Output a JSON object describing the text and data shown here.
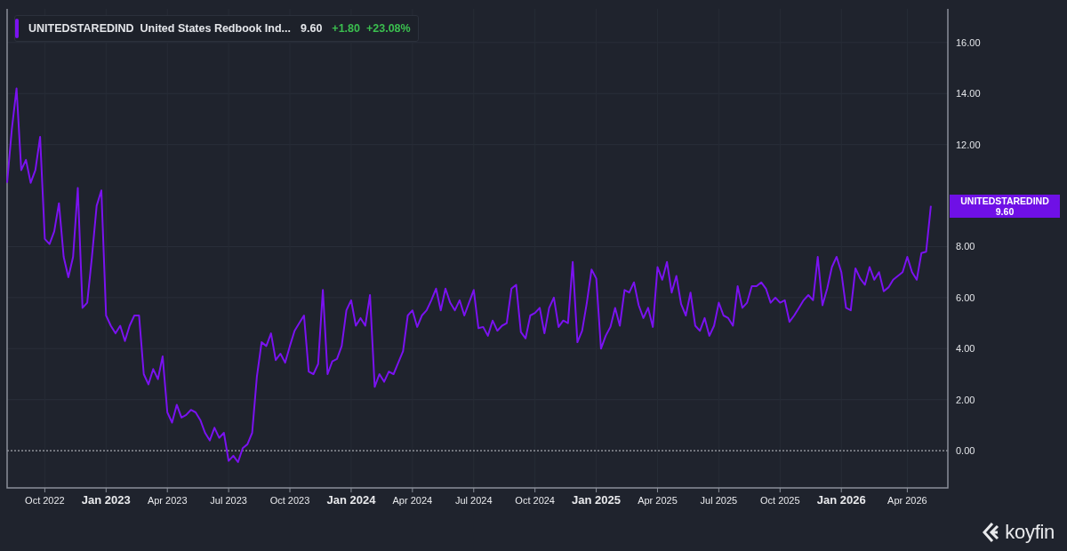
{
  "legend": {
    "name": "United States Redbook Ind...",
    "value": "9.60",
    "change": "+1.80",
    "change_percent": "+23.08%",
    "color": "#7a12f0"
  },
  "price_tag": {
    "ticker": "UNITEDSTAREDIND",
    "value": "9.60"
  },
  "chart": {
    "bold_xticks": [
      false,
      true,
      false,
      false,
      false,
      true,
      false,
      false,
      false,
      true,
      false,
      false,
      false,
      true,
      false
    ],
    "chart_data": {
      "type": "line",
      "grid": true,
      "ref_lines": [
        {
          "axis": "y",
          "value": 0
        }
      ],
      "ylim": [
        -1.46,
        17.32
      ],
      "categories": [
        null,
        null,
        null,
        null,
        null,
        null,
        null,
        null,
        "Oct 2022",
        null,
        null,
        null,
        null,
        null,
        null,
        null,
        null,
        null,
        null,
        null,
        null,
        "Jan 2023",
        null,
        null,
        null,
        null,
        null,
        null,
        null,
        null,
        null,
        null,
        null,
        null,
        "Apr 2023",
        null,
        null,
        null,
        null,
        null,
        null,
        null,
        null,
        null,
        null,
        null,
        null,
        "Jul 2023",
        null,
        null,
        null,
        null,
        null,
        null,
        null,
        null,
        null,
        null,
        null,
        null,
        "Oct 2023",
        null,
        null,
        null,
        null,
        null,
        null,
        null,
        null,
        null,
        null,
        null,
        null,
        "Jan 2024",
        null,
        null,
        null,
        null,
        null,
        null,
        null,
        null,
        null,
        null,
        null,
        null,
        "Apr 2024",
        null,
        null,
        null,
        null,
        null,
        null,
        null,
        null,
        null,
        null,
        null,
        null,
        "Jul 2024",
        null,
        null,
        null,
        null,
        null,
        null,
        null,
        null,
        null,
        null,
        null,
        null,
        "Oct 2024",
        null,
        null,
        null,
        null,
        null,
        null,
        null,
        null,
        null,
        null,
        null,
        null,
        "Jan 2025",
        null,
        null,
        null,
        null,
        null,
        null,
        null,
        null,
        null,
        null,
        null,
        null,
        "Apr 2025",
        null,
        null,
        null,
        null,
        null,
        null,
        null,
        null,
        null,
        null,
        null,
        null,
        "Jul 2025",
        null,
        null,
        null,
        null,
        null,
        null,
        null,
        null,
        null,
        null,
        null,
        null,
        "Oct 2025",
        null,
        null,
        null,
        null,
        null,
        null,
        null,
        null,
        null,
        null,
        null,
        null,
        "Jan 2026",
        null,
        null,
        null,
        null,
        null,
        null,
        null,
        null,
        null,
        null,
        null,
        null,
        null,
        "Apr 2026",
        null,
        null,
        null,
        null,
        null
      ],
      "yticks": [
        {
          "value": 0,
          "label": "0.00"
        },
        {
          "value": 2,
          "label": "2.00"
        },
        {
          "value": 4,
          "label": "4.00"
        },
        {
          "value": 6,
          "label": "6.00"
        },
        {
          "value": 8,
          "label": "8.00"
        },
        {
          "value": 12,
          "label": "12.00"
        },
        {
          "value": 14,
          "label": "14.00"
        },
        {
          "value": 16,
          "label": "16.00"
        }
      ],
      "series": [
        {
          "name": "UNITEDSTAREDIND",
          "color": "#7a12f0",
          "values": [
            10.5,
            12.6,
            14.2,
            11,
            11.4,
            10.5,
            11,
            12.3,
            8.3,
            8.1,
            8.6,
            9.7,
            7.6,
            6.8,
            7.6,
            10.3,
            5.6,
            5.8,
            7.6,
            9.6,
            10.2,
            5.3,
            4.9,
            4.6,
            4.9,
            4.3,
            4.9,
            5.3,
            5.3,
            3.0,
            2.6,
            3.2,
            2.8,
            3.7,
            1.5,
            1.1,
            1.8,
            1.3,
            1.4,
            1.6,
            1.5,
            1.2,
            0.7,
            0.4,
            0.9,
            0.5,
            0.7,
            -0.4,
            -0.2,
            -0.45,
            0.1,
            0.25,
            0.7,
            2.9,
            4.25,
            4.1,
            4.6,
            3.55,
            3.8,
            3.45,
            4.1,
            4.7,
            5.0,
            5.3,
            3.1,
            3.0,
            3.4,
            6.3,
            3.0,
            3.5,
            3.6,
            4.1,
            5.5,
            5.9,
            4.9,
            5.2,
            4.9,
            6.1,
            2.5,
            3.0,
            2.7,
            3.1,
            3.0,
            3.45,
            3.9,
            5.3,
            5.5,
            4.85,
            5.3,
            5.5,
            5.9,
            6.35,
            5.5,
            6.35,
            5.8,
            5.5,
            5.9,
            5.3,
            5.8,
            6.3,
            4.8,
            4.85,
            4.5,
            5.1,
            4.7,
            4.9,
            5.0,
            6.35,
            6.5,
            4.65,
            4.4,
            5.3,
            5.4,
            5.6,
            4.6,
            5.6,
            6.0,
            4.85,
            5.1,
            5.0,
            7.4,
            4.25,
            4.7,
            5.8,
            7.1,
            6.75,
            4.0,
            4.5,
            4.85,
            5.6,
            4.9,
            6.3,
            6.2,
            6.6,
            5.7,
            5.2,
            5.6,
            4.85,
            7.2,
            6.7,
            7.4,
            6.2,
            6.85,
            5.75,
            5.3,
            6.2,
            4.9,
            4.7,
            5.2,
            4.5,
            4.9,
            5.8,
            5.3,
            5.2,
            4.9,
            6.45,
            5.6,
            5.8,
            6.45,
            6.45,
            6.6,
            6.35,
            5.8,
            6.0,
            5.8,
            5.9,
            5.05,
            5.3,
            5.6,
            5.9,
            6.1,
            5.9,
            7.6,
            5.7,
            6.35,
            7.2,
            7.6,
            7.0,
            5.6,
            5.5,
            7.15,
            6.75,
            6.5,
            7.2,
            6.7,
            7.0,
            6.25,
            6.4,
            6.7,
            6.85,
            7.0,
            7.6,
            7.0,
            6.7,
            7.75,
            7.8,
            9.6
          ]
        }
      ]
    }
  },
  "logo": {
    "text": "koyfin"
  }
}
